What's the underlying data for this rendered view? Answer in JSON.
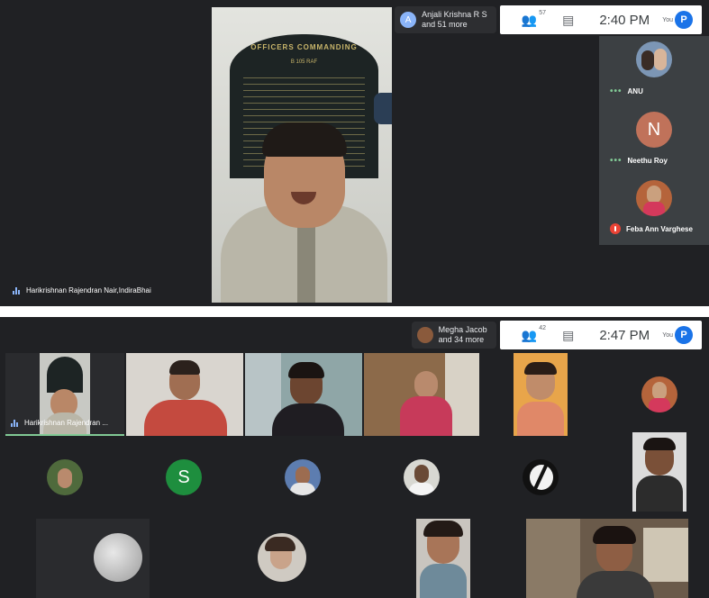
{
  "panel1": {
    "presenter_chip": {
      "line1": "Anjali Krishna R S",
      "line2": "and 51 more",
      "avatar_letter": "A"
    },
    "participants_count": "57",
    "time": "2:40 PM",
    "you_label": "You",
    "self_avatar_letter": "P",
    "main_video_name": "Harikrishnan Rajendran Nair,IndiraBhai",
    "side_participants": [
      {
        "name": "ANU",
        "status": "speaking-dots"
      },
      {
        "name": "Neethu Roy",
        "avatar_letter": "N",
        "status": "speaking-dots"
      },
      {
        "name": "Feba Ann Varghese",
        "status": "muted"
      }
    ],
    "board_heading": "OFFICERS COMMANDING",
    "board_unit": "B 105 RAF"
  },
  "panel2": {
    "presenter_chip": {
      "line1": "Megha Jacob",
      "line2": "and 34 more"
    },
    "participants_count": "42",
    "time": "2:47 PM",
    "you_label": "You",
    "self_avatar_letter": "P",
    "first_tile_name": "Harikrishnan Rajendran ...",
    "letter_avatar": "S"
  },
  "colors": {
    "bg": "#202124",
    "side_bg": "#3c4043",
    "accent_blue": "#1a73e8",
    "neethu_avatar": "#c0725a",
    "s_avatar": "#1e8e3e"
  }
}
